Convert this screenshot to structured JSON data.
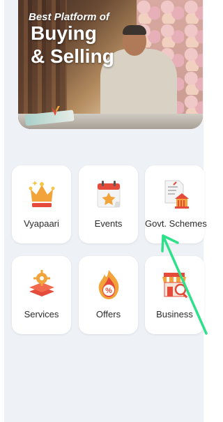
{
  "banner": {
    "line1": "Best Platform of",
    "line2": "Buying",
    "line3": "& Selling"
  },
  "tiles": [
    {
      "label": "Vyapaari",
      "icon": "crown-icon"
    },
    {
      "label": "Events",
      "icon": "calendar-star-icon"
    },
    {
      "label": "Govt. Schemes",
      "icon": "government-document-icon"
    },
    {
      "label": "Services",
      "icon": "layered-stack-gear-icon"
    },
    {
      "label": "Offers",
      "icon": "percent-flame-icon"
    },
    {
      "label": "Business",
      "icon": "storefront-search-icon"
    }
  ],
  "colors": {
    "background": "#eef1f6",
    "tile": "#ffffff",
    "accent_orange": "#f2a33a",
    "accent_red": "#e44b3a",
    "arrow": "#2ee08a"
  }
}
